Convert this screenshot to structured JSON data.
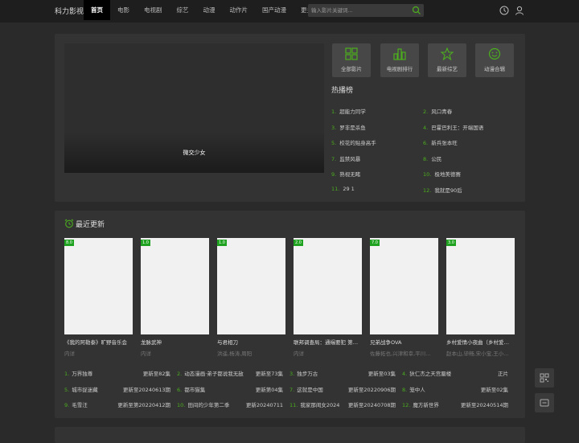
{
  "header": {
    "logo": "科力影视",
    "nav": [
      "首页",
      "电影",
      "电视剧",
      "综艺",
      "动漫",
      "动作片",
      "国产动漫",
      "更多"
    ],
    "search_placeholder": "输入影片关键词..."
  },
  "categories": [
    "全部影片",
    "电视剧排行",
    "最新综艺",
    "动漫合辑"
  ],
  "banner": {
    "title": "微交少女"
  },
  "hot": {
    "title": "热播榜",
    "items": [
      {
        "n": "1.",
        "t": "超能力同学"
      },
      {
        "n": "2.",
        "t": "风口青春"
      },
      {
        "n": "3.",
        "t": "罗非是杀鱼"
      },
      {
        "n": "4.",
        "t": "巴霍巴利王：开端国语"
      },
      {
        "n": "5.",
        "t": "校花的贴身高手"
      },
      {
        "n": "6.",
        "t": "新兵张本旺"
      },
      {
        "n": "7.",
        "t": "监禁风暴"
      },
      {
        "n": "8.",
        "t": "公民"
      },
      {
        "n": "9.",
        "t": "熟视无睹"
      },
      {
        "n": "10.",
        "t": "极地美德赛"
      },
      {
        "n": "11.",
        "t": "29 1"
      },
      {
        "n": "12.",
        "t": "我就是90后"
      }
    ]
  },
  "latest": {
    "title": "最近更新",
    "cards": [
      {
        "tag": "8.0",
        "title": "《我的阿勒泰》旷野音乐会",
        "sub": "内详"
      },
      {
        "tag": "1.0",
        "title": "龙脉武神",
        "sub": "内详"
      },
      {
        "tag": "1.0",
        "title": "与君相刀",
        "sub": "洪遥,杨涛,周阳"
      },
      {
        "tag": "2.0",
        "title": "联邦调查局：通缉要犯 第…",
        "sub": "内详"
      },
      {
        "tag": "7.0",
        "title": "兄弟战争OVA",
        "sub": "佐藤拓也,兴津和幸,平川…"
      },
      {
        "tag": "3.0",
        "title": "乡村爱情小夜曲（乡村爱…",
        "sub": "赵本山,毕畅,宋小宝,王小…"
      }
    ],
    "updates": [
      {
        "n": "1.",
        "t": "万界独尊",
        "s": "更新至82集"
      },
      {
        "n": "2.",
        "t": "动态漫画·弟子都说我无敌",
        "s": "更新至73集"
      },
      {
        "n": "3.",
        "t": "独步万古",
        "s": "更新至03集"
      },
      {
        "n": "4.",
        "t": "狄仁杰之天宫蜃楼",
        "s": "正片"
      },
      {
        "n": "5.",
        "t": "城市捉迷藏",
        "s": "更新至20240613期"
      },
      {
        "n": "6.",
        "t": "都市猫集",
        "s": "更新第04集"
      },
      {
        "n": "7.",
        "t": "这就是中国",
        "s": "更新至20220906期"
      },
      {
        "n": "8.",
        "t": "笼中人",
        "s": "更新至02集"
      },
      {
        "n": "9.",
        "t": "毛雪汪",
        "s": "更新至第20220412期"
      },
      {
        "n": "10.",
        "t": "田间的少年第二季",
        "s": "更新20240711"
      },
      {
        "n": "11.",
        "t": "我家那闺女2024",
        "s": "更新至20240708期"
      },
      {
        "n": "12.",
        "t": "魔方新世界",
        "s": "更新至20240514期"
      }
    ]
  },
  "colors": {
    "accent": "#4caf1e",
    "badge": "#1fa21f"
  }
}
